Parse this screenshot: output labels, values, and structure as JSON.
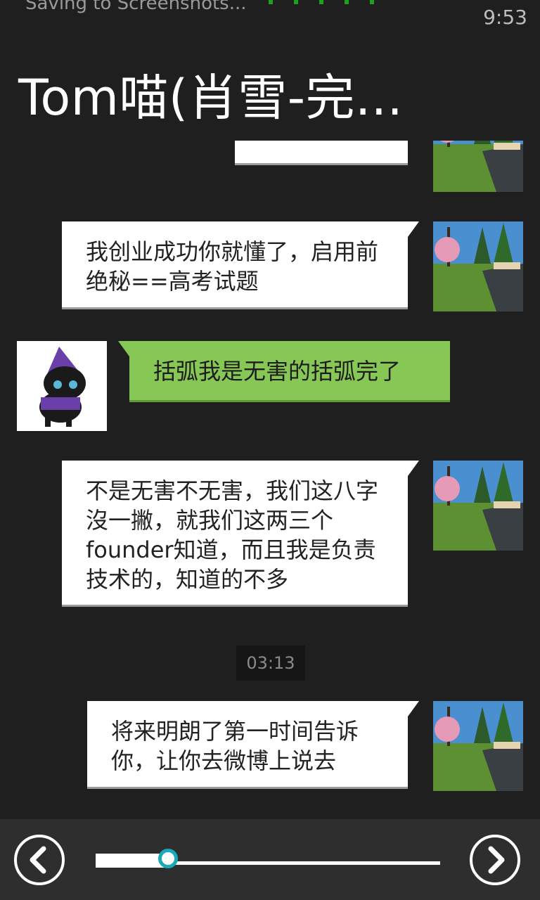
{
  "status_bar": {
    "saving_text": "Saving to Screenshots...",
    "time": "9:53"
  },
  "header": {
    "title": "Tom喵(肖雪-完..."
  },
  "messages": [
    {
      "direction": "out",
      "text": ""
    },
    {
      "direction": "out",
      "text": "我创业成功你就懂了，启用前绝秘==高考试题"
    },
    {
      "direction": "in",
      "text": "括弧我是无害的括弧完了"
    },
    {
      "direction": "out",
      "text": "不是无害不无害，我们这八字沒一撇，就我们这两三个founder知道，而且我是负责技术的，知道的不多"
    },
    {
      "direction": "out",
      "text": "将来明朗了第一时间告诉你，让你去微博上说去"
    }
  ],
  "timestamp": "03:13",
  "toolbar": {
    "prev_icon": "chevron-left-icon",
    "next_icon": "chevron-right-icon",
    "progress": 0.21
  },
  "colors": {
    "incoming_bubble": "#86c755",
    "outgoing_bubble": "#ffffff",
    "slider_accent": "#1aa9b8",
    "background": "#1f1f1f"
  }
}
